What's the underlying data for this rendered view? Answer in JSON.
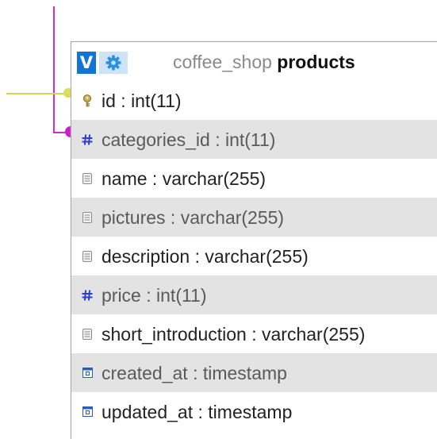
{
  "table": {
    "v_label": "V",
    "db_name": "coffee_shop",
    "table_name": "products",
    "columns": [
      {
        "icon": "key-icon",
        "text": "id : int(11)"
      },
      {
        "icon": "hash-icon",
        "text": "categories_id : int(11)"
      },
      {
        "icon": "field-icon",
        "text": "name : varchar(255)"
      },
      {
        "icon": "field-icon",
        "text": "pictures : varchar(255)"
      },
      {
        "icon": "field-icon",
        "text": "description : varchar(255)"
      },
      {
        "icon": "hash-icon",
        "text": "price : int(11)"
      },
      {
        "icon": "field-icon",
        "text": "short_introduction : varchar(255)"
      },
      {
        "icon": "calendar-icon",
        "text": "created_at : timestamp"
      },
      {
        "icon": "calendar-icon",
        "text": "updated_at : timestamp"
      }
    ]
  },
  "colors": {
    "relation_line": "#d12ad3",
    "reference_line": "#d8d64a",
    "accent": "#1474d6"
  }
}
